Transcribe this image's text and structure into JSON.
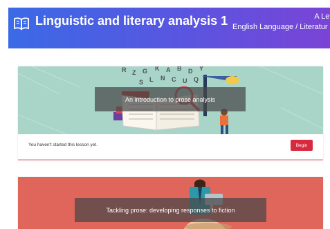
{
  "header": {
    "title": "Linguistic and literary analysis 1",
    "course_level": "A Leve",
    "course_subject": "English Language / Literatur"
  },
  "lessons": [
    {
      "title": "An introduction to prose analysis",
      "status": "You haven't started this lesson yet.",
      "action_label": "Begin"
    },
    {
      "title": "Tackling prose: developing responses to fiction"
    }
  ],
  "colors": {
    "header_start": "#3b6ae6",
    "header_end": "#7a44d6",
    "card1_bg": "#a9d4c8",
    "card2_bg": "#e0655a",
    "accent": "#d9293f"
  }
}
